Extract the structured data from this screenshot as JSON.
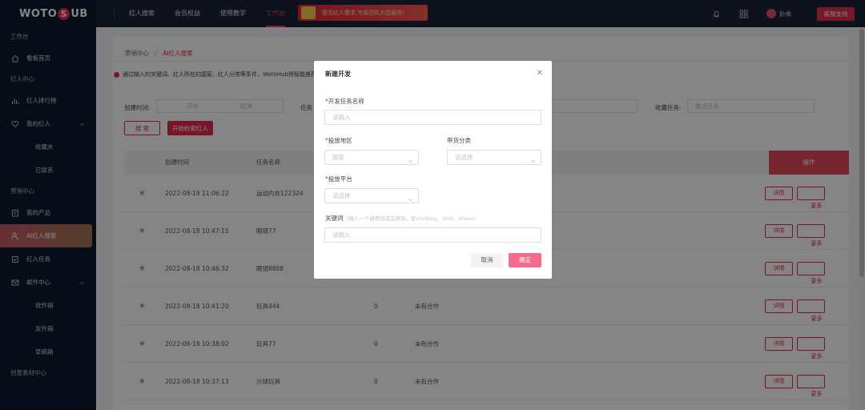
{
  "brand": {
    "logo_left": "WOTO",
    "logo_badge": "S",
    "logo_right": "UB"
  },
  "sidebar": {
    "sec_workbench": "工作台",
    "item_dashboard": "看板首页",
    "sec_influencer": "红人中心",
    "item_ranking": "红人排行榜",
    "item_my_influencers": "我的红人",
    "sub_favorites": "收藏夹",
    "sub_contacted": "已联系",
    "sec_marketing": "营销中心",
    "item_products": "我的产品",
    "item_ai_search": "AI红人搜索",
    "item_tasks": "红人任务",
    "item_mail": "邮件中心",
    "sub_inbox": "收件箱",
    "sub_outbox": "发件箱",
    "sub_drafts": "草稿箱",
    "sec_creative": "创意素材中心"
  },
  "topnav": {
    "items": [
      "红人搜索",
      "会员权益",
      "使用教学",
      "工作台"
    ],
    "promo": "提交红人需求,专属团队为您服务!",
    "username": "卧佛",
    "support": "客服支持"
  },
  "main": {
    "crumb_root": "营销中心",
    "crumb_sep": "/",
    "crumb_current": "AI红人搜索",
    "tip": "通过输入的关键词、红人所在的国家、红人分类等条件，WotoHub将智能推荐",
    "filter_created": "创建时间:",
    "date_start": "开始",
    "date_end": "结束",
    "filter_task": "任务",
    "filter_fav": "收藏任务:",
    "fav_placeholder": "重点任务",
    "btn_search": "搜 索",
    "btn_start": "开始检索红人",
    "col_created": "创建时间",
    "col_task": "任务名称",
    "col_op": "操作",
    "detail_label": "详情",
    "more_label": "更多",
    "rows": [
      {
        "time": "2022-08-18 11:06:22",
        "name": "运动内衣122324",
        "count": "",
        "status": ""
      },
      {
        "time": "2022-08-18 10:47:15",
        "name": "眼镜77",
        "count": "",
        "status": ""
      },
      {
        "time": "2022-08-18 10:46:32",
        "name": "眼镜8888",
        "count": "",
        "status": ""
      },
      {
        "time": "2022-08-18 10:41:20",
        "name": "玩具444",
        "count": "0",
        "status": "未有合作"
      },
      {
        "time": "2022-08-18 10:38:02",
        "name": "玩具77",
        "count": "0",
        "status": "未有合作"
      },
      {
        "time": "2022-08-18 10:37:13",
        "name": "沙球玩具",
        "count": "0",
        "status": "未有合作"
      }
    ]
  },
  "modal": {
    "title": "新建开发",
    "task_name_label": "开发任务名称",
    "task_name_placeholder": "请输入",
    "region_label": "投放地区",
    "region_placeholder": "国家",
    "category_label": "带货分类",
    "category_placeholder": "请选择",
    "platform_label": "投放平台",
    "platform_placeholder": "请选择",
    "keyword_label": "关键词",
    "keyword_hint": "(输入一个通用词或品牌词，如clothing、skirt、shoes)",
    "keyword_placeholder": "请输入",
    "cancel": "取消",
    "ok": "确定"
  }
}
